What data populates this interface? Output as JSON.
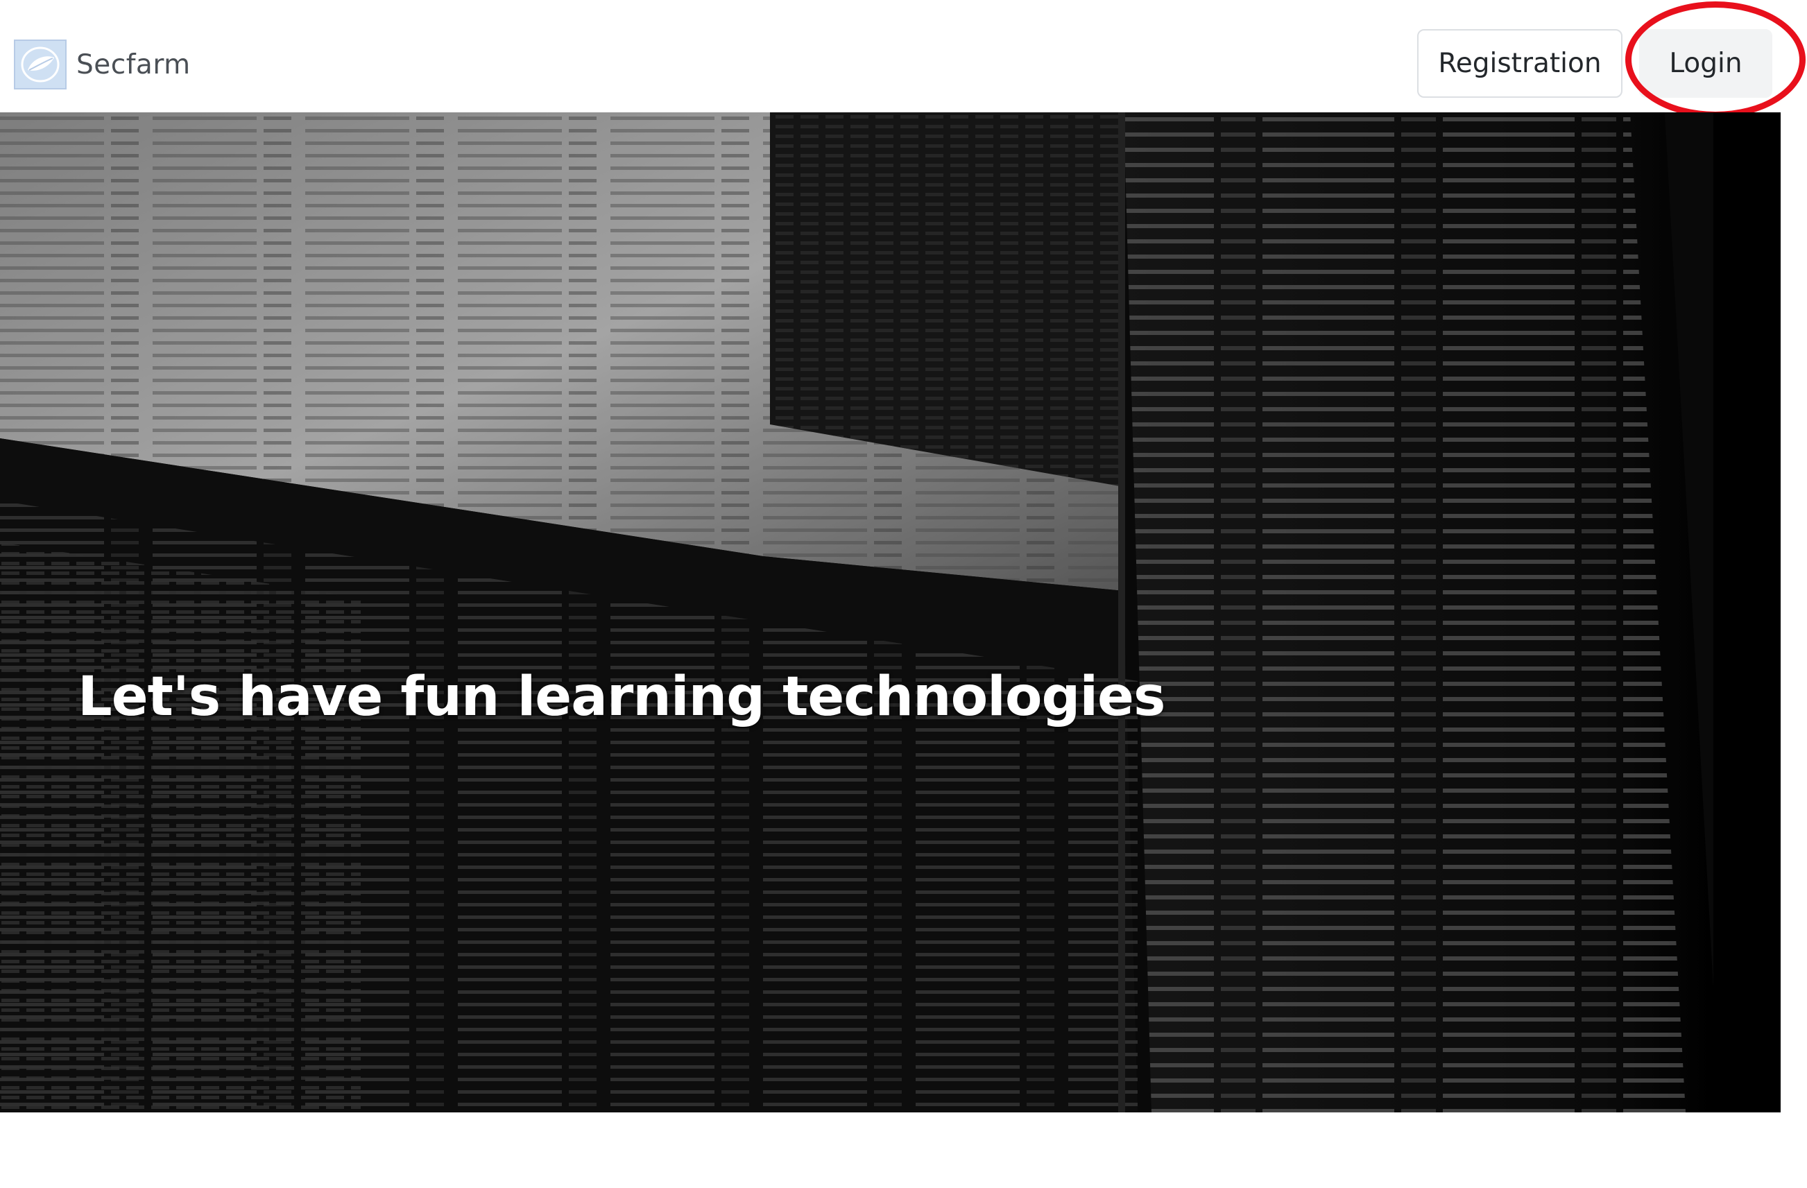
{
  "header": {
    "brand_name": "Secfarm",
    "logo_icon": "leaf-logo-icon",
    "registration_label": "Registration",
    "login_label": "Login",
    "highlight_color": "#e8101c"
  },
  "hero": {
    "title": "Let's have fun learning technologies",
    "background": "dark terminal screens photo"
  }
}
